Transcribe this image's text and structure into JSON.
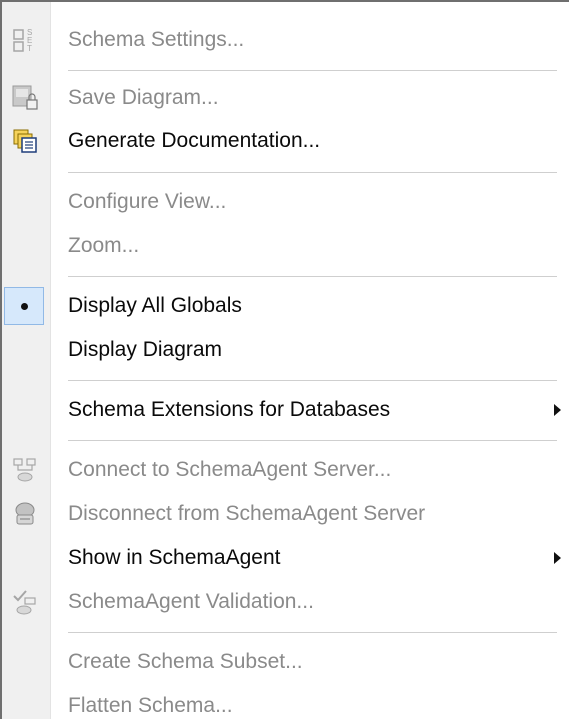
{
  "menu": {
    "items": [
      {
        "label": "Schema Settings...",
        "icon": "schema-settings-icon",
        "enabled": false
      },
      {
        "label": "Save Diagram...",
        "icon": "save-diagram-icon",
        "enabled": false
      },
      {
        "label": "Generate Documentation...",
        "icon": "generate-documentation-icon",
        "enabled": true
      },
      {
        "label": "Configure View...",
        "enabled": false
      },
      {
        "label": "Zoom...",
        "enabled": false
      },
      {
        "label": "Display All Globals",
        "enabled": true,
        "checked": true
      },
      {
        "label": "Display Diagram",
        "enabled": true
      },
      {
        "label": "Schema Extensions for Databases",
        "enabled": true,
        "submenu": true
      },
      {
        "label": "Connect to SchemaAgent Server...",
        "icon": "connect-server-icon",
        "enabled": false
      },
      {
        "label": "Disconnect from SchemaAgent Server",
        "icon": "disconnect-server-icon",
        "enabled": false
      },
      {
        "label": "Show in SchemaAgent",
        "enabled": true,
        "submenu": true
      },
      {
        "label": "SchemaAgent Validation...",
        "icon": "schemaagent-validation-icon",
        "enabled": false
      },
      {
        "label": "Create Schema Subset...",
        "enabled": false
      },
      {
        "label": "Flatten Schema...",
        "enabled": false
      }
    ]
  }
}
